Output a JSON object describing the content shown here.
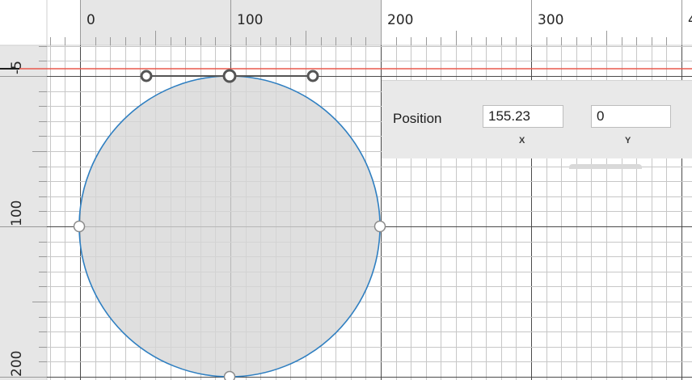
{
  "rulers": {
    "top_labels": [
      "0",
      "100",
      "200",
      "300",
      "4"
    ],
    "left_labels": [
      "-5",
      "100",
      "200"
    ]
  },
  "inspector": {
    "position_label": "Position",
    "x_value": "155.23",
    "y_value": "0",
    "x_caption": "X",
    "y_caption": "Y"
  },
  "colors": {
    "circle_fill": "#d6d6d6",
    "circle_stroke": "#2f7fc1",
    "guide_line": "#e8584d",
    "ruler_bg": "#e6e6e6",
    "handle_stroke": "#555555"
  }
}
